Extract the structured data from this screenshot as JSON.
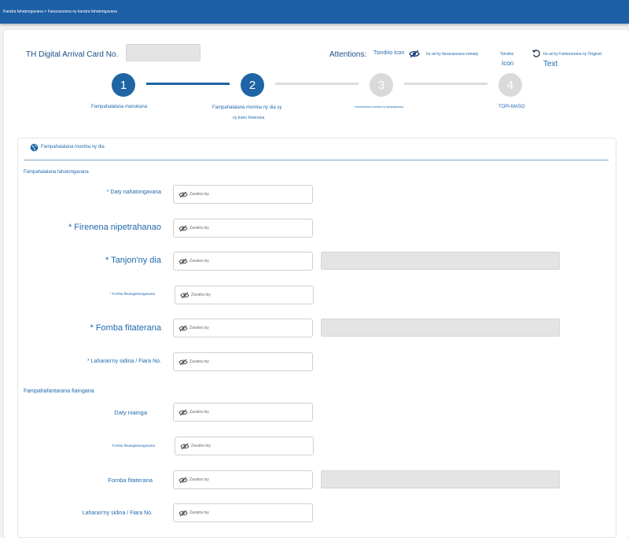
{
  "topbar": {
    "breadcrumb": "Karatra fahatongavana > Fanavaozana ny karatra fahatongavana"
  },
  "header": {
    "card_label": "TH Digital Arrival Card No.",
    "attentions_label": "Attentions:",
    "icon_hint": "Tsindrio Icon",
    "hide_hint": "ho an'ny fanavaozana votoaty",
    "tsindrio": "Tsindrio",
    "icon_word": "Icon",
    "restore_hint": "ho an'ny Famerenana ny Original",
    "text_word": "Text"
  },
  "steps": [
    {
      "number": "1",
      "label": "Fampahalalana manokana",
      "state": "active"
    },
    {
      "number": "2",
      "label": "Fampahalalana momba ny dia sy",
      "label2": "ny trano fonenana",
      "state": "active"
    },
    {
      "number": "3",
      "label": "Fanambarana momba ny fahasalamana",
      "state": "inactive"
    },
    {
      "number": "4",
      "label": "TOPI-MASO",
      "state": "inactive"
    }
  ],
  "section": {
    "title": "Fampahalalana momba ny dia",
    "arrival_group": "Fampahalalana fahatongavana",
    "departure_group": "Fampahafantarana fiaingana"
  },
  "fields": {
    "placeholder": "Zavatra tsy",
    "arrival_date": "* Daty nahatongavana",
    "nationality": "* Firenena nipetrahanao",
    "travel_purpose": "* Tanjon'ny dia",
    "accommodation": "* Fomba fitsangatsanganana",
    "travel_mode": "* Fomba fitaterana",
    "flight_no": "* Laharan'ny sidina / Fiara No.",
    "departure_date": "Daty niainga",
    "dep_accommodation": "Fomba fitsangatsanganana",
    "dep_travel_mode": "Fomba fitaterana",
    "dep_flight_no": "Laharan'ny sidina / Fiara No."
  },
  "colors": {
    "brand": "#1c5fa5",
    "accent_text": "#1f69ad",
    "inactive_step": "#dadada"
  },
  "icons": {
    "eye_off": "eye-off-icon",
    "globe": "globe-icon",
    "undo": "undo-icon"
  }
}
